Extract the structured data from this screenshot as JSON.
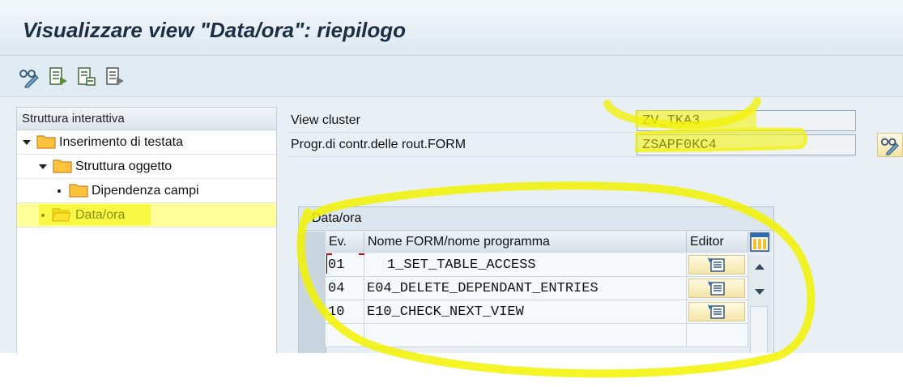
{
  "window": {
    "title": "Visualizzare view \"Data/ora\": riepilogo"
  },
  "toolbar": {
    "buttons": [
      {
        "icon": "glasses-pencil-icon"
      },
      {
        "icon": "export-document-icon"
      },
      {
        "icon": "import-document-icon"
      },
      {
        "icon": "document-arrow-icon"
      }
    ]
  },
  "tree": {
    "header": "Struttura interattiva",
    "items": [
      {
        "label": "Inserimento di testata",
        "level": 0,
        "expanded": true,
        "selected": false
      },
      {
        "label": "Struttura oggetto",
        "level": 1,
        "expanded": true,
        "selected": false
      },
      {
        "label": "Dipendenza campi",
        "level": 2,
        "expanded": false,
        "selected": false
      },
      {
        "label": "Data/ora",
        "level": 0,
        "expanded": false,
        "selected": true
      }
    ]
  },
  "form": {
    "view_cluster_label": "View cluster",
    "view_cluster_value": "ZV_TKA3",
    "program_label": "Progr.di contr.delle rout.FORM",
    "program_value": "ZSAPF0KC4"
  },
  "table": {
    "caption": "Data/ora",
    "columns": {
      "event": "Ev.",
      "form": "Nome FORM/nome programma",
      "editor": "Editor"
    },
    "rows": [
      {
        "event": "01",
        "form": "1_SET_TABLE_ACCESS"
      },
      {
        "event": "04",
        "form": "E04_DELETE_DEPENDANT_ENTRIES"
      },
      {
        "event": "10",
        "form": "E10_CHECK_NEXT_VIEW"
      }
    ]
  },
  "colors": {
    "highlight": "#f2f200",
    "selection": "#ffff99",
    "folder": "#ffc23d"
  }
}
